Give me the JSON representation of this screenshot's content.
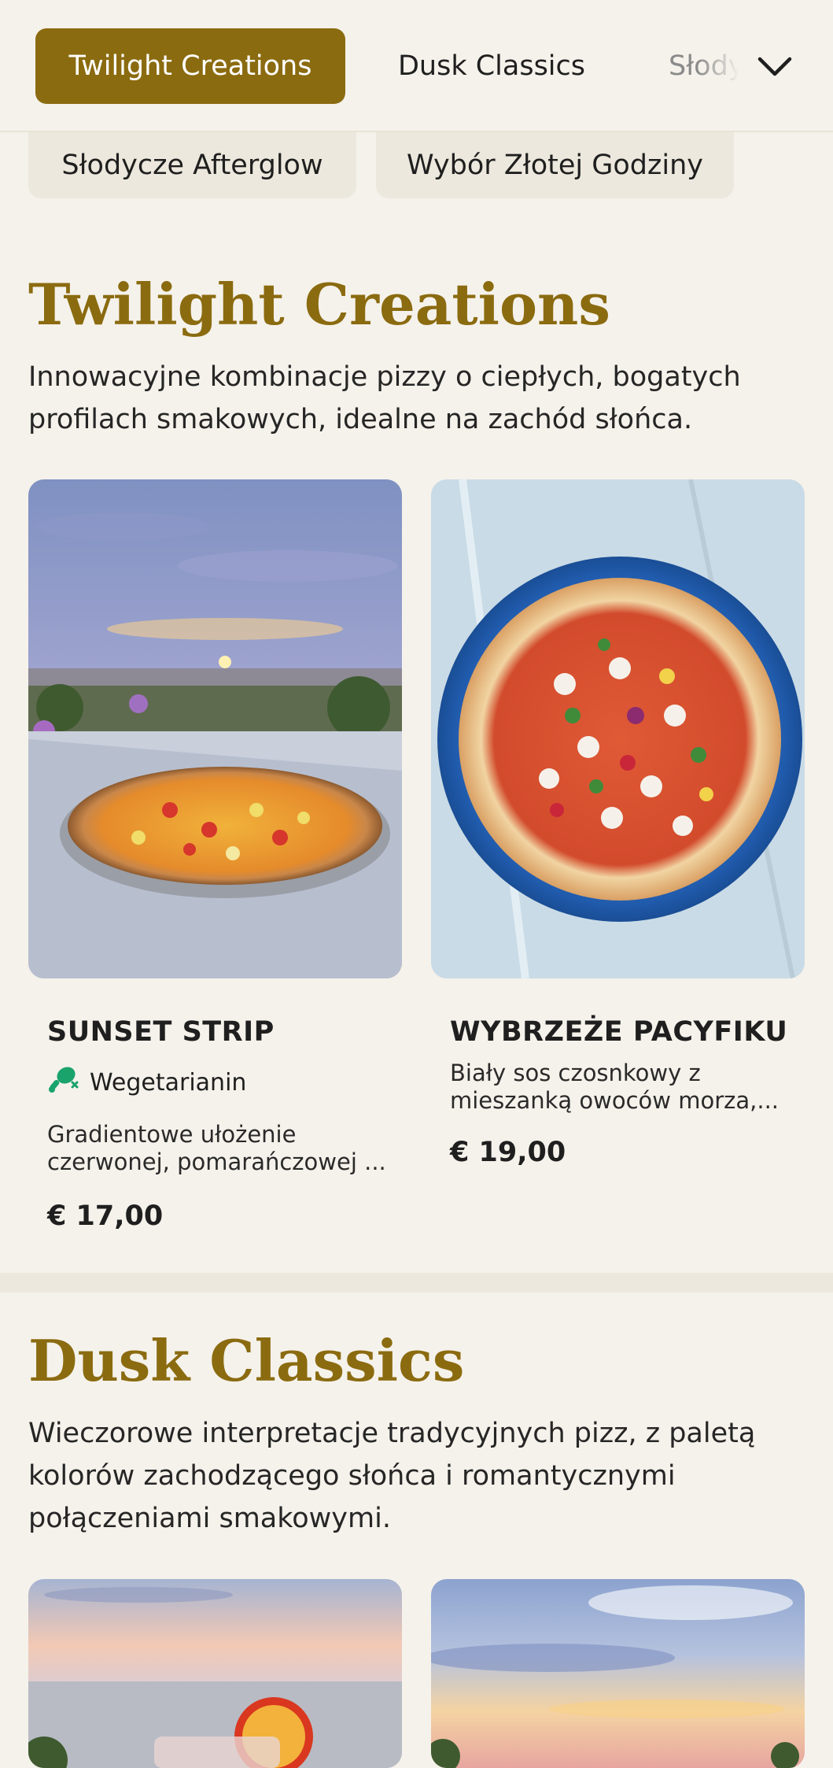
{
  "nav": {
    "tabs": [
      {
        "label": "Twilight Creations",
        "active": true
      },
      {
        "label": "Dusk Classics",
        "active": false
      },
      {
        "label": "Słodycze Afterglow",
        "active": false
      }
    ],
    "more_icon": "chevron-down-icon",
    "chips": [
      "Słodycze Afterglow",
      "Wybór Złotej Godziny"
    ]
  },
  "sections": [
    {
      "title": "Twilight Creations",
      "description": "Innowacyjne kombinacje pizzy o ciepłych, bogatych profilach smakowych, idealne na zachód słońca.",
      "items": [
        {
          "name": "SUNSET STRIP",
          "tag": "Wegetarianin",
          "tag_icon": "vegetarian-drumstick-crossed-icon",
          "description": "Gradientowe ułożenie czerwonej, pomarańczowej ...",
          "price": "€ 17,00"
        },
        {
          "name": "WYBRZEŻE PACYFIKU",
          "description": "Biały sos czosnkowy z mieszanką owoców morza,...",
          "price": "€ 19,00"
        }
      ]
    },
    {
      "title": "Dusk Classics",
      "description": "Wieczorowe interpretacje tradycyjnych pizz, z paletą kolorów zachodzącego słońca i romantycznymi połączeniami smakowymi."
    }
  ],
  "colors": {
    "accent": "#8b6b10",
    "background": "#f5f2eb",
    "chip_bg": "#ece8dd",
    "veg_green": "#1aa36b"
  }
}
